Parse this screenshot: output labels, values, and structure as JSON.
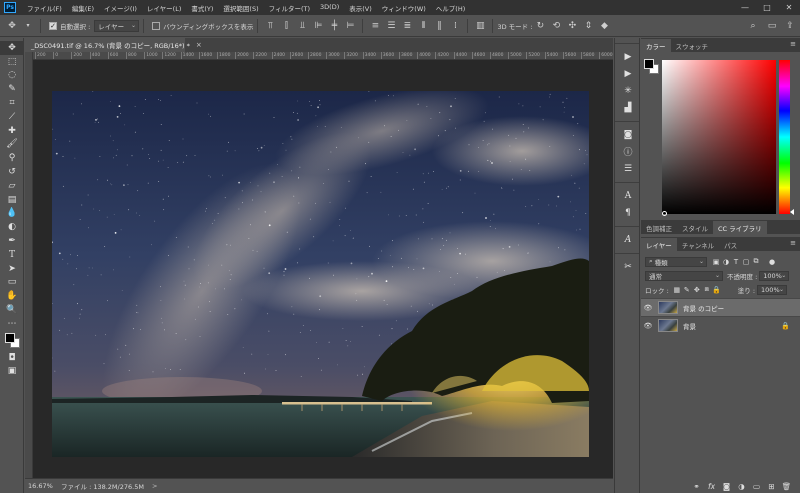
{
  "menubar": {
    "logo": "Ps",
    "items": [
      "ファイル(F)",
      "編集(E)",
      "イメージ(I)",
      "レイヤー(L)",
      "書式(Y)",
      "選択範囲(S)",
      "フィルター(T)",
      "3D(D)",
      "表示(V)",
      "ウィンドウ(W)",
      "ヘルプ(H)"
    ],
    "window_controls": [
      "—",
      "□",
      "✕"
    ]
  },
  "options": {
    "auto_select_label": "自動選択 :",
    "auto_select_value": "レイヤー",
    "bounding_box_label": "バウンディングボックスを表示",
    "mode_3d_label": "3D モード :"
  },
  "document": {
    "tab_title": "_DSC0491.tif @ 16.7% (背景 のコピー, RGB/16*) *",
    "close": "×",
    "ruler_ticks": [
      "200",
      "0",
      "200",
      "400",
      "600",
      "800",
      "1000",
      "1200",
      "1400",
      "1600",
      "1800",
      "2000",
      "2200",
      "2400",
      "2600",
      "2800",
      "3000",
      "3200",
      "3400",
      "3600",
      "3800",
      "4000",
      "4200",
      "4400",
      "4600",
      "4800",
      "5000",
      "5200",
      "5400",
      "5600",
      "5800",
      "6000"
    ]
  },
  "status": {
    "zoom": "16.67%",
    "file_info": "ファイル : 138.2M/276.5M",
    "arrow": ">"
  },
  "color_panel": {
    "tabs": [
      "カラー",
      "スウォッチ"
    ],
    "hue_color": "#ff0000"
  },
  "adjust_panel": {
    "tabs": [
      "色調補正",
      "スタイル",
      "CC ライブラリ"
    ]
  },
  "layers_panel": {
    "tabs": [
      "レイヤー",
      "チャンネル",
      "パス"
    ],
    "filter_kind": "種類",
    "blend_mode": "通常",
    "opacity_label": "不透明度 :",
    "opacity_value": "100%",
    "lock_label": "ロック :",
    "fill_label": "塗り :",
    "fill_value": "100%",
    "layers": [
      {
        "name": "背景 のコピー",
        "selected": true,
        "locked": false
      },
      {
        "name": "背景",
        "selected": false,
        "locked": true
      }
    ],
    "bottom_icons": [
      "link-icon",
      "fx-icon",
      "mask-icon",
      "adjustment-icon",
      "group-icon",
      "new-layer-icon",
      "trash-icon"
    ]
  }
}
